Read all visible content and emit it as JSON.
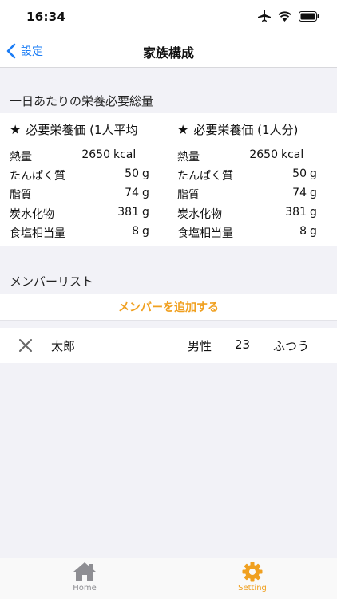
{
  "status_bar": {
    "time": "16:34"
  },
  "nav": {
    "back_label": "設定",
    "title": "家族構成"
  },
  "nutrition": {
    "section_title": "一日あたりの栄養必要総量",
    "columns": [
      {
        "title": "必要栄養価 (1人平均",
        "rows": [
          {
            "label": "熱量",
            "value": "2650",
            "unit": "kcal"
          },
          {
            "label": "たんぱく質",
            "value": "50",
            "unit": "g"
          },
          {
            "label": "脂質",
            "value": "74",
            "unit": "g"
          },
          {
            "label": "炭水化物",
            "value": "381",
            "unit": "g"
          },
          {
            "label": "食塩相当量",
            "value": "8",
            "unit": "g"
          }
        ]
      },
      {
        "title": "必要栄養価 (1人分)",
        "rows": [
          {
            "label": "熱量",
            "value": "2650",
            "unit": "kcal"
          },
          {
            "label": "たんぱく質",
            "value": "50",
            "unit": "g"
          },
          {
            "label": "脂質",
            "value": "74",
            "unit": "g"
          },
          {
            "label": "炭水化物",
            "value": "381",
            "unit": "g"
          },
          {
            "label": "食塩相当量",
            "value": "8",
            "unit": "g"
          }
        ]
      }
    ]
  },
  "members": {
    "section_title": "メンバーリスト",
    "add_label": "メンバーを追加する",
    "items": [
      {
        "name": "太郎",
        "gender": "男性",
        "age": "23",
        "activity": "ふつう"
      }
    ]
  },
  "tab_bar": {
    "tabs": [
      {
        "label": "Home",
        "icon": "house-icon",
        "active": false
      },
      {
        "label": "Setting",
        "icon": "gear-icon",
        "active": true
      }
    ]
  },
  "colors": {
    "accent": "#f0a020",
    "link": "#1a7cf5",
    "inactive": "#8e8e93"
  }
}
